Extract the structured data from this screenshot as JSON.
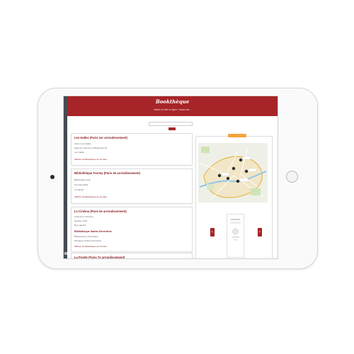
{
  "app": {
    "brand": "Bookthèque",
    "tagline": "Visitez la ville en ligne. Toutes les..."
  },
  "search": {
    "placeholder": ""
  },
  "results": [
    {
      "title": "Les Halles (Paris 1er arrondissement)",
      "lines": [
        "Forum Les Halles",
        "Salle de cinéma et bibliothèque (5)",
        "Les Halles"
      ],
      "link": "Afficher la bibliothèque sur la carte"
    },
    {
      "title": "Bibliothèque Forney (Paris 4e arrondissement)",
      "lines": [
        "Bibliothèque d'art",
        "Arts décoratifs",
        "Le Marais"
      ],
      "link": "Afficher la bibliothèque sur la carte"
    },
    {
      "title": "Le Cinéma (Paris 5e arrondissement)",
      "lines": [
        "Cinéma Le Champo",
        "Quartier Latin",
        "Rive gauche"
      ],
      "subtitle": "Bibliothèque Sainte-Geneviève",
      "sublines": [
        "Bibliothèque universitaire",
        "Montagne Sainte-Geneviève"
      ],
      "link": "Afficher la bibliothèque sur la carte"
    },
    {
      "title": "La Pointe (Paris 7e arrondissement)",
      "lines": [],
      "link": ""
    }
  ],
  "colors": {
    "brand_red": "#a72428",
    "link_red": "#8a1f22",
    "accent_orange": "#f5a53b",
    "rail": "#454a52"
  },
  "icons": {
    "prev": "chevron-left-icon",
    "next": "chevron-right-icon"
  }
}
